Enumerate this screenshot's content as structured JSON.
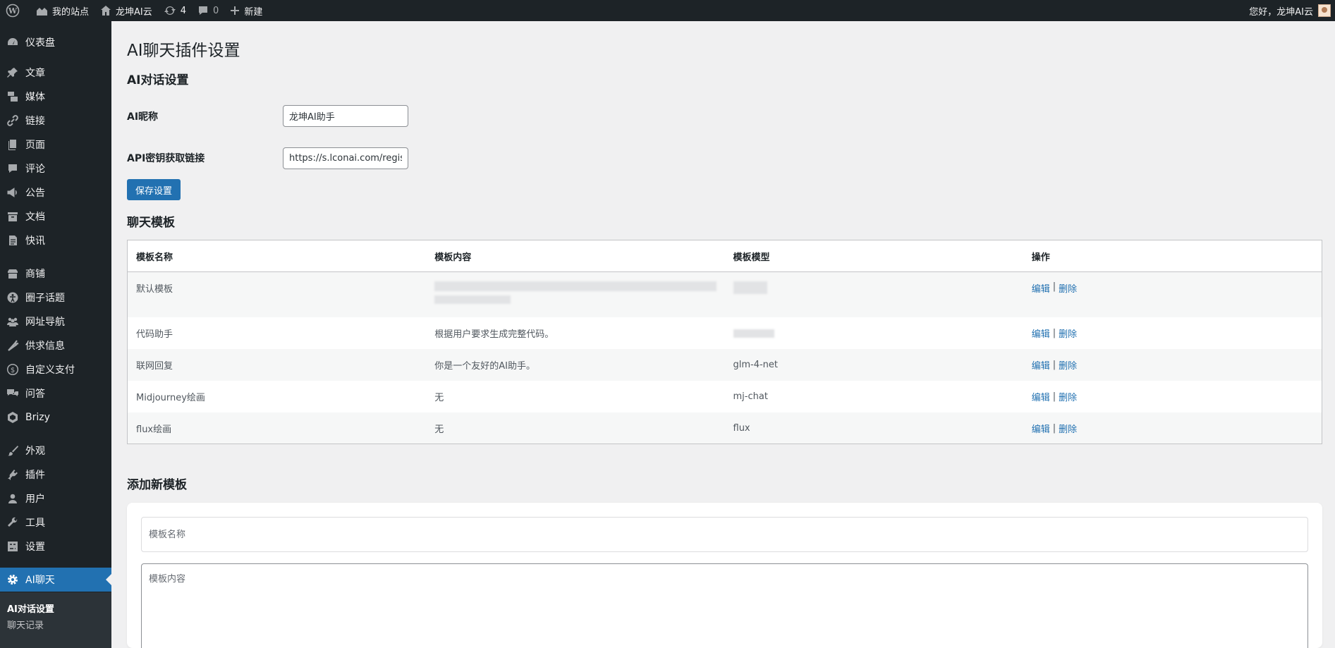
{
  "adminbar": {
    "my_site": "我的站点",
    "site_name": "龙坤AI云",
    "updates_count": "4",
    "comments_count": "0",
    "new_label": "新建",
    "greeting": "您好，龙坤AI云"
  },
  "sidebar": {
    "items": [
      {
        "label": "仪表盘",
        "icon": "dashboard-icon"
      },
      {
        "label": "文章",
        "icon": "pin-icon"
      },
      {
        "label": "媒体",
        "icon": "media-icon"
      },
      {
        "label": "链接",
        "icon": "link-icon"
      },
      {
        "label": "页面",
        "icon": "page-icon"
      },
      {
        "label": "评论",
        "icon": "comment-icon"
      },
      {
        "label": "公告",
        "icon": "megaphone-icon"
      },
      {
        "label": "文档",
        "icon": "archive-icon"
      },
      {
        "label": "快讯",
        "icon": "document-icon"
      },
      {
        "label": "商铺",
        "icon": "store-icon"
      },
      {
        "label": "圈子话题",
        "icon": "accessibility-icon"
      },
      {
        "label": "网址导航",
        "icon": "groups-icon"
      },
      {
        "label": "供求信息",
        "icon": "carrot-icon"
      },
      {
        "label": "自定义支付",
        "icon": "dollar-icon"
      },
      {
        "label": "问答",
        "icon": "chat-icon"
      },
      {
        "label": "Brizy",
        "icon": "brizy-icon"
      },
      {
        "label": "外观",
        "icon": "brush-icon"
      },
      {
        "label": "插件",
        "icon": "plugin-icon"
      },
      {
        "label": "用户",
        "icon": "user-icon"
      },
      {
        "label": "工具",
        "icon": "wrench-icon"
      },
      {
        "label": "设置",
        "icon": "settings-icon"
      },
      {
        "label": "AI聊天",
        "icon": "gear-icon"
      }
    ],
    "submenu": [
      {
        "label": "AI对话设置"
      },
      {
        "label": "聊天记录"
      }
    ]
  },
  "main": {
    "page_title": "AI聊天插件设置",
    "section_dialog": "AI对话设置",
    "nickname_label": "AI昵称",
    "nickname_value": "龙坤AI助手",
    "api_label": "API密钥获取链接",
    "api_value": "https://s.lconai.com/register",
    "save_button": "保存设置",
    "section_templates": "聊天模板",
    "table": {
      "headers": [
        "模板名称",
        "模板内容",
        "模板模型",
        "操作"
      ],
      "edit_label": "编辑",
      "delete_label": "删除",
      "rows": [
        {
          "name": "默认模板",
          "content": "",
          "model": ""
        },
        {
          "name": "代码助手",
          "content": "根据用户要求生成完整代码。",
          "model": ""
        },
        {
          "name": "联网回复",
          "content": "你是一个友好的AI助手。",
          "model": "glm-4-net"
        },
        {
          "name": "Midjourney绘画",
          "content": "无",
          "model": "mj-chat"
        },
        {
          "name": "flux绘画",
          "content": "无",
          "model": "flux"
        }
      ]
    },
    "section_add": "添加新模板",
    "add_name_placeholder": "模板名称",
    "add_content_placeholder": "模板内容"
  }
}
